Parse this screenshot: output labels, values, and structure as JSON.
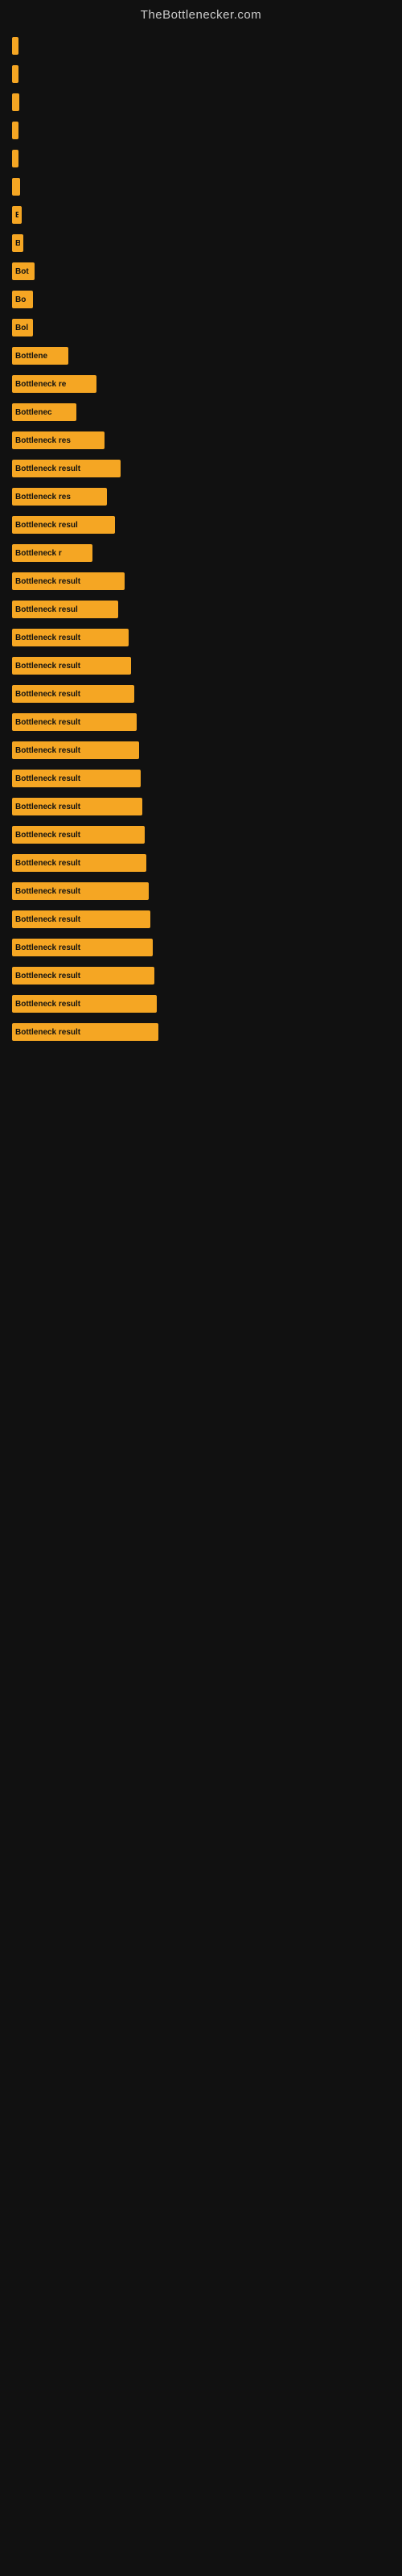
{
  "site": {
    "title": "TheBottlenecker.com"
  },
  "bars": [
    {
      "label": "",
      "width": 8
    },
    {
      "label": "",
      "width": 8
    },
    {
      "label": "",
      "width": 9
    },
    {
      "label": "",
      "width": 8
    },
    {
      "label": "",
      "width": 8
    },
    {
      "label": "",
      "width": 10
    },
    {
      "label": "B",
      "width": 12
    },
    {
      "label": "B",
      "width": 14
    },
    {
      "label": "Bot",
      "width": 28
    },
    {
      "label": "Bo",
      "width": 26
    },
    {
      "label": "Bol",
      "width": 26
    },
    {
      "label": "Bottlene",
      "width": 70
    },
    {
      "label": "Bottleneck re",
      "width": 105
    },
    {
      "label": "Bottlenec",
      "width": 80
    },
    {
      "label": "Bottleneck res",
      "width": 115
    },
    {
      "label": "Bottleneck result",
      "width": 135
    },
    {
      "label": "Bottleneck res",
      "width": 118
    },
    {
      "label": "Bottleneck resul",
      "width": 128
    },
    {
      "label": "Bottleneck r",
      "width": 100
    },
    {
      "label": "Bottleneck result",
      "width": 140
    },
    {
      "label": "Bottleneck resul",
      "width": 132
    },
    {
      "label": "Bottleneck result",
      "width": 145
    },
    {
      "label": "Bottleneck result",
      "width": 148
    },
    {
      "label": "Bottleneck result",
      "width": 152
    },
    {
      "label": "Bottleneck result",
      "width": 155
    },
    {
      "label": "Bottleneck result",
      "width": 158
    },
    {
      "label": "Bottleneck result",
      "width": 160
    },
    {
      "label": "Bottleneck result",
      "width": 162
    },
    {
      "label": "Bottleneck result",
      "width": 165
    },
    {
      "label": "Bottleneck result",
      "width": 167
    },
    {
      "label": "Bottleneck result",
      "width": 170
    },
    {
      "label": "Bottleneck result",
      "width": 172
    },
    {
      "label": "Bottleneck result",
      "width": 175
    },
    {
      "label": "Bottleneck result",
      "width": 177
    },
    {
      "label": "Bottleneck result",
      "width": 180
    },
    {
      "label": "Bottleneck result",
      "width": 182
    }
  ]
}
